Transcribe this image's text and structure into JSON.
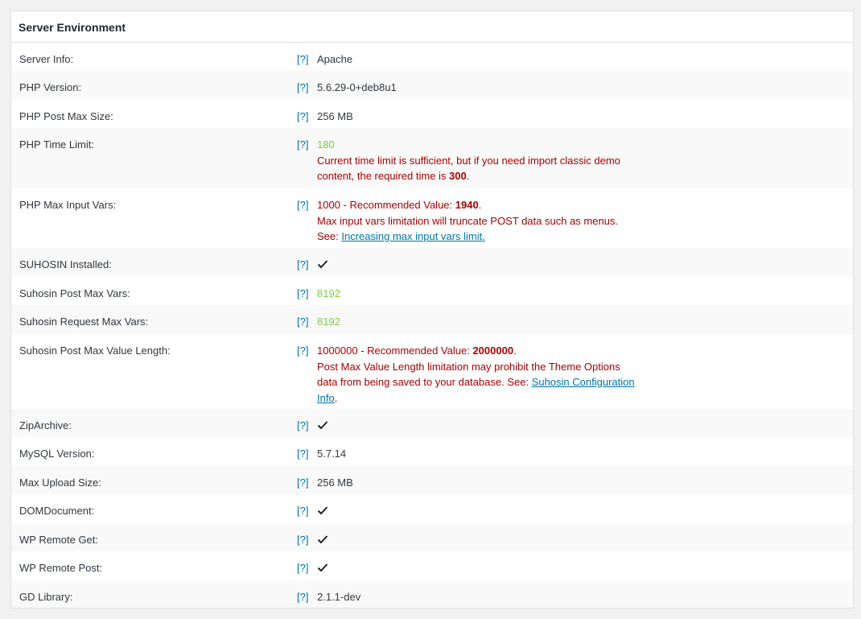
{
  "header": {
    "title": "Server Environment"
  },
  "help_label": "[?]",
  "rows": {
    "server_info": {
      "label": "Server Info:",
      "value": "Apache"
    },
    "php_version": {
      "label": "PHP Version:",
      "value": "5.6.29-0+deb8u1"
    },
    "php_post_max": {
      "label": "PHP Post Max Size:",
      "value": "256 MB"
    },
    "php_time_limit": {
      "label": "PHP Time Limit:",
      "value": "180",
      "msg_1": "Current time limit is sufficient, but if you need import classic demo content, the required time is ",
      "msg_bold": "300",
      "msg_end": "."
    },
    "php_max_input": {
      "label": "PHP Max Input Vars:",
      "value_prefix": "1000 - Recommended Value: ",
      "value_bold": "1940",
      "value_end": ".",
      "msg_1": "Max input vars limitation will truncate POST data such as menus.",
      "see": "See: ",
      "link": "Increasing max input vars limit."
    },
    "suhosin_installed": {
      "label": "SUHOSIN Installed:"
    },
    "suhosin_post_max_vars": {
      "label": "Suhosin Post Max Vars:",
      "value": "8192"
    },
    "suhosin_request_max_vars": {
      "label": "Suhosin Request Max Vars:",
      "value": "8192"
    },
    "suhosin_post_max_value": {
      "label": "Suhosin Post Max Value Length:",
      "value_prefix": "1000000 - Recommended Value: ",
      "value_bold": "2000000",
      "value_end": ".",
      "msg_1": "Post Max Value Length limitation may prohibit the Theme Options data from being saved to your database. See: ",
      "link": "Suhosin Configuration Info",
      "msg_end": "."
    },
    "zip_archive": {
      "label": "ZipArchive:"
    },
    "mysql_version": {
      "label": "MySQL Version:",
      "value": "5.7.14"
    },
    "max_upload": {
      "label": "Max Upload Size:",
      "value": "256 MB"
    },
    "dom_document": {
      "label": "DOMDocument:"
    },
    "wp_remote_get": {
      "label": "WP Remote Get:"
    },
    "wp_remote_post": {
      "label": "WP Remote Post:"
    },
    "gd_library": {
      "label": "GD Library:",
      "value": "2.1.1-dev"
    }
  }
}
